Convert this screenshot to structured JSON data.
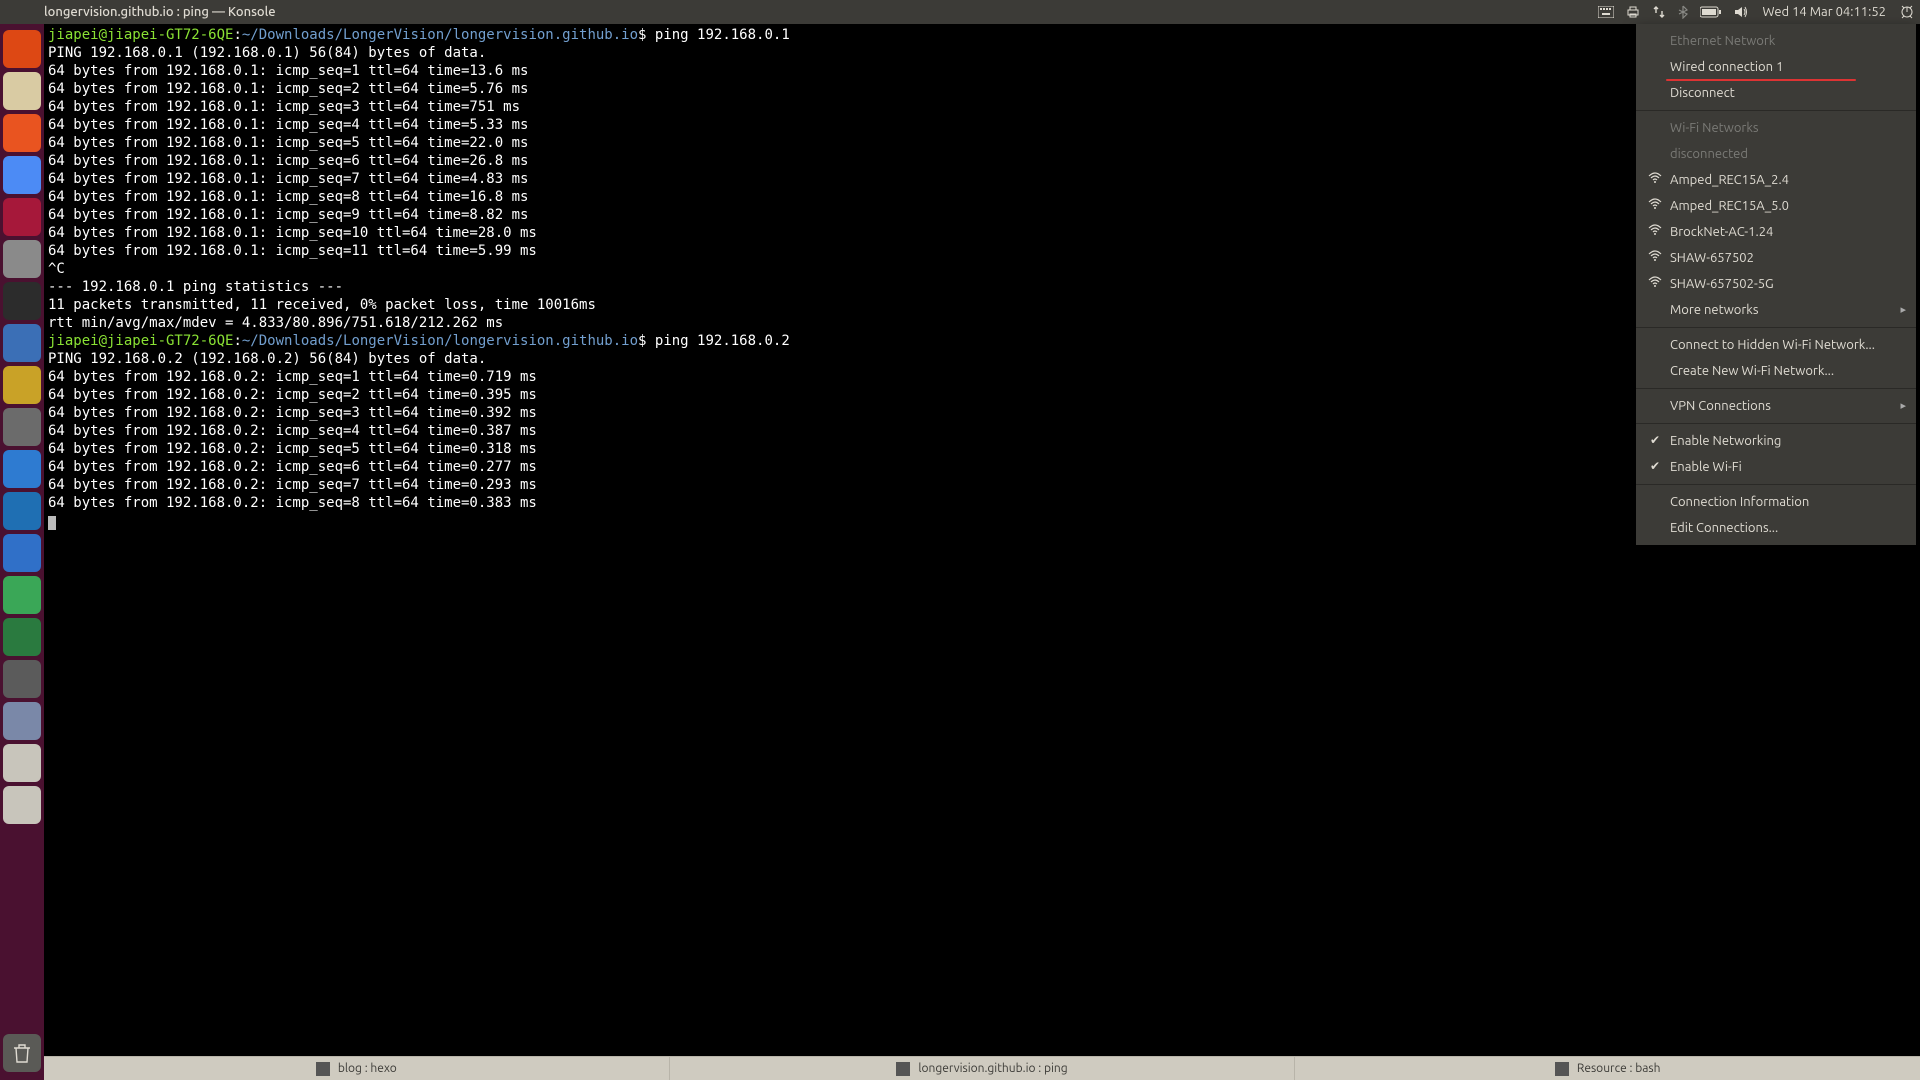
{
  "top_panel": {
    "title": "longervision.github.io : ping — Konsole",
    "datetime": "Wed 14 Mar 04:11:52"
  },
  "terminal": {
    "lines": [
      {
        "type": "prompt",
        "user": "jiapei@jiapei-GT72-6QE",
        "path": "~/Downloads/LongerVision/longervision.github.io",
        "cmd": "ping 192.168.0.1"
      },
      {
        "type": "out",
        "text": "PING 192.168.0.1 (192.168.0.1) 56(84) bytes of data."
      },
      {
        "type": "out",
        "text": "64 bytes from 192.168.0.1: icmp_seq=1 ttl=64 time=13.6 ms"
      },
      {
        "type": "out",
        "text": "64 bytes from 192.168.0.1: icmp_seq=2 ttl=64 time=5.76 ms"
      },
      {
        "type": "out",
        "text": "64 bytes from 192.168.0.1: icmp_seq=3 ttl=64 time=751 ms"
      },
      {
        "type": "out",
        "text": "64 bytes from 192.168.0.1: icmp_seq=4 ttl=64 time=5.33 ms"
      },
      {
        "type": "out",
        "text": "64 bytes from 192.168.0.1: icmp_seq=5 ttl=64 time=22.0 ms"
      },
      {
        "type": "out",
        "text": "64 bytes from 192.168.0.1: icmp_seq=6 ttl=64 time=26.8 ms"
      },
      {
        "type": "out",
        "text": "64 bytes from 192.168.0.1: icmp_seq=7 ttl=64 time=4.83 ms"
      },
      {
        "type": "out",
        "text": "64 bytes from 192.168.0.1: icmp_seq=8 ttl=64 time=16.8 ms"
      },
      {
        "type": "out",
        "text": "64 bytes from 192.168.0.1: icmp_seq=9 ttl=64 time=8.82 ms"
      },
      {
        "type": "out",
        "text": "64 bytes from 192.168.0.1: icmp_seq=10 ttl=64 time=28.0 ms"
      },
      {
        "type": "out",
        "text": "64 bytes from 192.168.0.1: icmp_seq=11 ttl=64 time=5.99 ms"
      },
      {
        "type": "out",
        "text": "^C"
      },
      {
        "type": "out",
        "text": "--- 192.168.0.1 ping statistics ---"
      },
      {
        "type": "out",
        "text": "11 packets transmitted, 11 received, 0% packet loss, time 10016ms"
      },
      {
        "type": "out",
        "text": "rtt min/avg/max/mdev = 4.833/80.896/751.618/212.262 ms"
      },
      {
        "type": "prompt",
        "user": "jiapei@jiapei-GT72-6QE",
        "path": "~/Downloads/LongerVision/longervision.github.io",
        "cmd": "ping 192.168.0.2"
      },
      {
        "type": "out",
        "text": "PING 192.168.0.2 (192.168.0.2) 56(84) bytes of data."
      },
      {
        "type": "out",
        "text": "64 bytes from 192.168.0.2: icmp_seq=1 ttl=64 time=0.719 ms"
      },
      {
        "type": "out",
        "text": "64 bytes from 192.168.0.2: icmp_seq=2 ttl=64 time=0.395 ms"
      },
      {
        "type": "out",
        "text": "64 bytes from 192.168.0.2: icmp_seq=3 ttl=64 time=0.392 ms"
      },
      {
        "type": "out",
        "text": "64 bytes from 192.168.0.2: icmp_seq=4 ttl=64 time=0.387 ms"
      },
      {
        "type": "out",
        "text": "64 bytes from 192.168.0.2: icmp_seq=5 ttl=64 time=0.318 ms"
      },
      {
        "type": "out",
        "text": "64 bytes from 192.168.0.2: icmp_seq=6 ttl=64 time=0.277 ms"
      },
      {
        "type": "out",
        "text": "64 bytes from 192.168.0.2: icmp_seq=7 ttl=64 time=0.293 ms"
      },
      {
        "type": "out",
        "text": "64 bytes from 192.168.0.2: icmp_seq=8 ttl=64 time=0.383 ms"
      }
    ]
  },
  "network_menu": {
    "ethernet_header": "Ethernet Network",
    "wired_connection": "Wired connection 1",
    "disconnect": "Disconnect",
    "wifi_header": "Wi-Fi Networks",
    "wifi_status": "disconnected",
    "networks": [
      "Amped_REC15A_2.4",
      "Amped_REC15A_5.0",
      "BrockNet-AC-1.24",
      "SHAW-657502",
      "SHAW-657502-5G"
    ],
    "more_networks": "More networks",
    "connect_hidden": "Connect to Hidden Wi-Fi Network...",
    "create_new": "Create New Wi-Fi Network...",
    "vpn": "VPN Connections",
    "enable_net": "Enable Networking",
    "enable_wifi": "Enable Wi-Fi",
    "conn_info": "Connection Information",
    "edit_conn": "Edit Connections..."
  },
  "bottom_bar": {
    "tasks": [
      "blog : hexo",
      "longervision.github.io : ping",
      "Resource : bash"
    ]
  },
  "launcher": {
    "items": [
      {
        "name": "dash",
        "color": "#dd4814"
      },
      {
        "name": "files",
        "color": "#d9cba3"
      },
      {
        "name": "software",
        "color": "#e95420"
      },
      {
        "name": "chromium",
        "color": "#4c8bf5"
      },
      {
        "name": "app-red",
        "color": "#a6183a"
      },
      {
        "name": "app-grey",
        "color": "#8a8a8a"
      },
      {
        "name": "terminal",
        "color": "#2c2c2c"
      },
      {
        "name": "jetbrains",
        "color": "#3b6fb6"
      },
      {
        "name": "app-yellow",
        "color": "#c9a227"
      },
      {
        "name": "settings",
        "color": "#6b6b6b"
      },
      {
        "name": "app-ball",
        "color": "#2e7bd1"
      },
      {
        "name": "code",
        "color": "#1f6fb3"
      },
      {
        "name": "shield",
        "color": "#3070c8"
      },
      {
        "name": "app-green1",
        "color": "#3aa757"
      },
      {
        "name": "app-green2",
        "color": "#2a7a3f"
      },
      {
        "name": "app-squares",
        "color": "#5b5b5b"
      },
      {
        "name": "app-img",
        "color": "#7a88a8"
      },
      {
        "name": "disk1",
        "color": "#c8c5bb"
      },
      {
        "name": "disk2",
        "color": "#c8c5bb"
      }
    ]
  }
}
